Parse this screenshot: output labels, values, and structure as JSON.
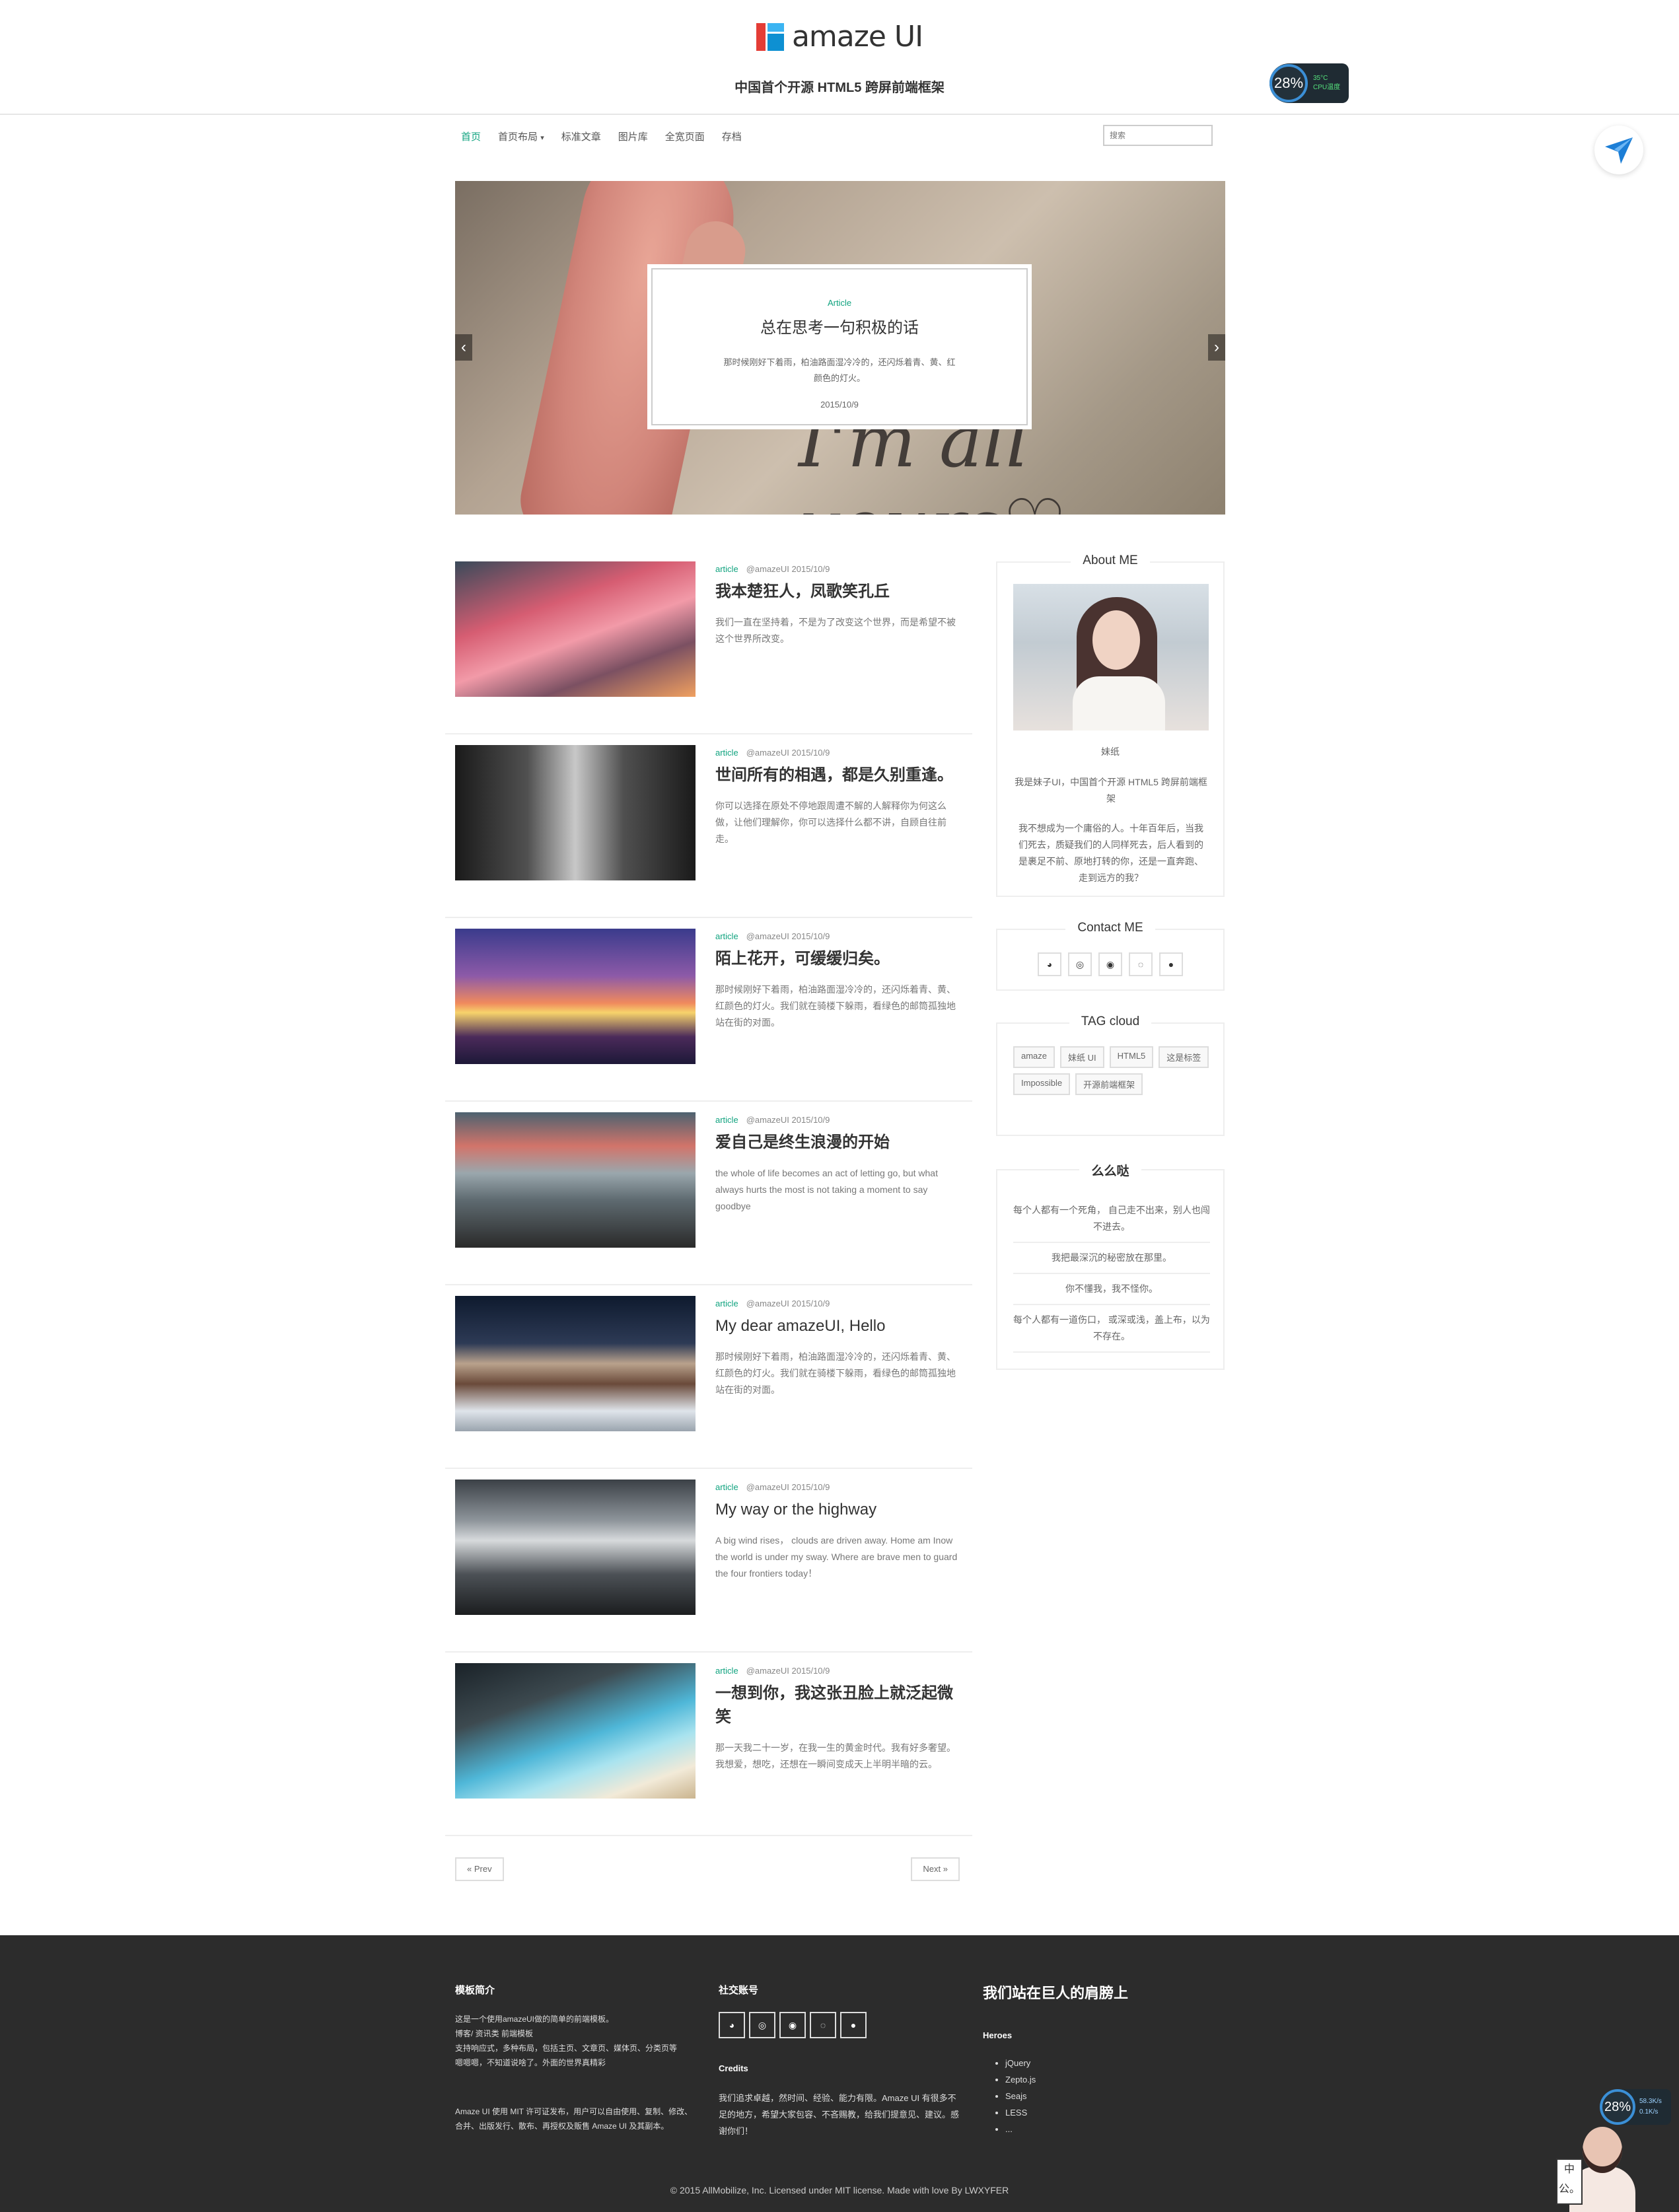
{
  "header": {
    "brand": "amaze UI",
    "tagline": "中国首个开源 HTML5 跨屏前端框架",
    "cpu_percent": "28%",
    "cpu_temp": "35°C",
    "cpu_label": "CPU温度"
  },
  "nav": {
    "items": [
      {
        "label": "首页",
        "active": true
      },
      {
        "label": "首页布局",
        "dropdown": true
      },
      {
        "label": "标准文章"
      },
      {
        "label": "图片库"
      },
      {
        "label": "全宽页面"
      },
      {
        "label": "存档"
      }
    ],
    "search_placeholder": "搜索"
  },
  "slider": {
    "tag": "Article",
    "title": "总在思考一句积极的话",
    "desc": "那时候刚好下着雨，柏油路面湿冷冷的，还闪烁着青、黄、红颜色的灯火。",
    "date": "2015/10/9",
    "script_text": "I'm all yours♡",
    "prev": "‹",
    "next": "›"
  },
  "articles": [
    {
      "tag": "article",
      "author": "@amazeUI",
      "date": "2015/10/9",
      "title": "我本楚狂人，凤歌笑孔丘",
      "desc": "我们一直在坚持着，不是为了改变这个世界，而是希望不被这个世界所改变。"
    },
    {
      "tag": "article",
      "author": "@amazeUI",
      "date": "2015/10/9",
      "title": "世间所有的相遇，都是久别重逢。",
      "desc": "你可以选择在原处不停地跟周遭不解的人解释你为何这么做，让他们理解你，你可以选择什么都不讲，自顾自往前走。"
    },
    {
      "tag": "article",
      "author": "@amazeUI",
      "date": "2015/10/9",
      "title": "陌上花开，可缓缓归矣。",
      "desc": "那时候刚好下着雨，柏油路面湿冷冷的，还闪烁着青、黄、红颜色的灯火。我们就在骑楼下躲雨，看绿色的邮筒孤独地站在街的对面。"
    },
    {
      "tag": "article",
      "author": "@amazeUI",
      "date": "2015/10/9",
      "title": "爱自己是终生浪漫的开始",
      "desc": "the whole of life becomes an act of letting go, but what always hurts the most is not taking a moment to say goodbye"
    },
    {
      "tag": "article",
      "author": "@amazeUI",
      "date": "2015/10/9",
      "title": "My dear amazeUI, Hello",
      "desc": "那时候刚好下着雨，柏油路面湿冷冷的，还闪烁着青、黄、红颜色的灯火。我们就在骑楼下躲雨，看绿色的邮筒孤独地站在街的对面。"
    },
    {
      "tag": "article",
      "author": "@amazeUI",
      "date": "2015/10/9",
      "title": "My way or the highway",
      "desc": "A big wind rises， clouds are driven away. Home am Inow the world is under my sway. Where are brave men to guard the four frontiers today！"
    },
    {
      "tag": "article",
      "author": "@amazeUI",
      "date": "2015/10/9",
      "title": "一想到你，我这张丑脸上就泛起微笑",
      "desc": "那一天我二十一岁，在我一生的黄金时代。我有好多奢望。我想爱，想吃，还想在一瞬间变成天上半明半暗的云。"
    }
  ],
  "pager": {
    "prev": "« Prev",
    "next": "Next »"
  },
  "sidebar": {
    "about": {
      "title": "About ME",
      "name": "妹纸",
      "intro": "我是妹子UI，中国首个开源 HTML5 跨屏前端框架",
      "text": "我不想成为一个庸俗的人。十年百年后，当我们死去，质疑我们的人同样死去，后人看到的是裹足不前、原地打转的你，还是一直奔跑、走到远方的我？"
    },
    "contact": {
      "title": "Contact ME",
      "icons": [
        "qq-icon",
        "github-icon",
        "weibo-icon",
        "renren-icon",
        "wechat-icon"
      ]
    },
    "tags": {
      "title": "TAG cloud",
      "items": [
        "amaze",
        "妹纸 UI",
        "HTML5",
        "这是标签",
        "Impossible",
        "开源前端框架"
      ]
    },
    "quotes": {
      "title": "么么哒",
      "items": [
        "每个人都有一个死角， 自己走不出来，别人也闯不进去。",
        "我把最深沉的秘密放在那里。",
        "你不懂我，我不怪你。",
        "每个人都有一道伤口， 或深或浅，盖上布，以为不存在。"
      ]
    }
  },
  "footer": {
    "col1": {
      "title": "模板简介",
      "lines": [
        "这是一个使用amazeUI做的简单的前端模板。",
        "博客/ 资讯类 前端模板",
        "支持响应式，多种布局，包括主页、文章页、媒体页、分类页等",
        "嗯嗯嗯，不知道说啥了。外面的世界真精彩"
      ],
      "license": "Amaze UI 使用 MIT 许可证发布，用户可以自由使用、复制、修改、合并、出版发行、散布、再授权及贩售 Amaze UI 及其副本。"
    },
    "col2": {
      "title": "社交账号",
      "credits_title": "Credits",
      "credits": "我们追求卓越，然时间、经验、能力有限。Amaze UI 有很多不足的地方，希望大家包容、不吝赐教，给我们提意见、建议。感谢你们！"
    },
    "col3": {
      "title": "我们站在巨人的肩膀上",
      "heroes_title": "Heroes",
      "heroes": [
        "jQuery",
        "Zepto.js",
        "Seajs",
        "LESS",
        "..."
      ]
    },
    "copyright": "© 2015 AllMobilize, Inc. Licensed under MIT license. Made with love By LWXYFER",
    "cpu_percent": "28%",
    "net_up": "58.3K/s",
    "net_down": "0.1K/s",
    "sign_text": "中公。"
  },
  "colors": {
    "accent": "#10a37f",
    "footer_bg": "#2c2c2c"
  }
}
